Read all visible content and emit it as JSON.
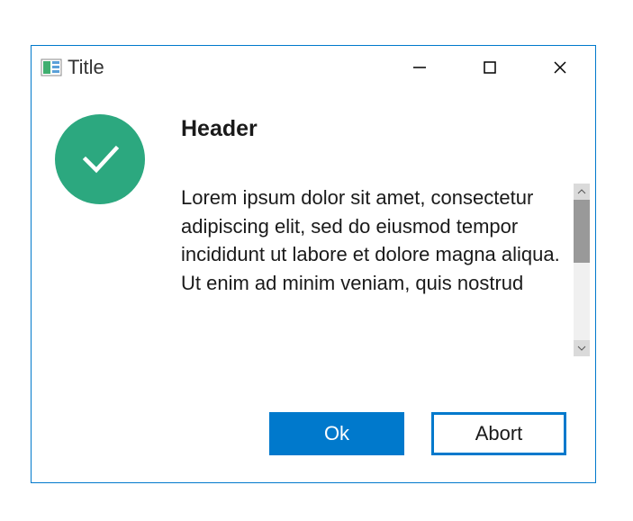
{
  "window": {
    "title": "Title"
  },
  "dialog": {
    "icon_type": "success-check",
    "header": "Header",
    "body": "Lorem ipsum dolor sit amet, consectetur adipiscing elit, sed do eiusmod tempor\nincididunt ut labore et dolore magna aliqua. Ut enim ad minim veniam, quis nostrud"
  },
  "buttons": {
    "ok_label": "Ok",
    "abort_label": "Abort"
  },
  "colors": {
    "accent": "#0079cc",
    "success": "#2ca87f"
  }
}
